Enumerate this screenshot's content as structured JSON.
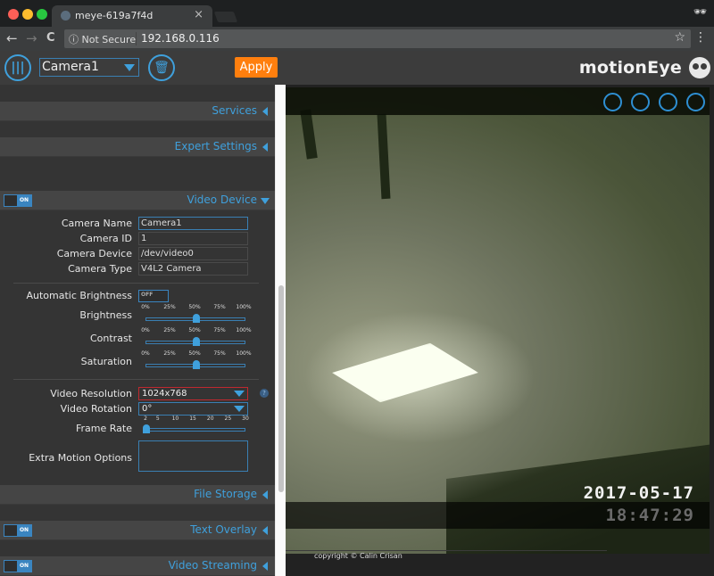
{
  "browser": {
    "tab_title": "meye-619a7f4d",
    "tab_close": "×",
    "security_label": "ⓘ Not Secure",
    "url": "192.168.0.116",
    "back": "←",
    "forward": "→",
    "reload": "C",
    "star": "☆",
    "menu": "⋮",
    "incognito": "🕶",
    "traffic_colors": [
      "#fc5f57",
      "#fdbc2e",
      "#28c840"
    ]
  },
  "header": {
    "menu_icon": "|||",
    "camera_select": "Camera1",
    "delete_icon": "🗑",
    "apply_label": "Apply",
    "brand": "motionEye"
  },
  "sections": {
    "services": "Services",
    "expert_settings": "Expert Settings",
    "video_device": "Video Device",
    "file_storage": "File Storage",
    "text_overlay": "Text Overlay",
    "video_streaming": "Video Streaming",
    "toggle_on": "ON"
  },
  "video_device": {
    "camera_name_label": "Camera Name",
    "camera_name": "Camera1",
    "camera_id_label": "Camera ID",
    "camera_id": "1",
    "camera_device_label": "Camera Device",
    "camera_device": "/dev/video0",
    "camera_type_label": "Camera Type",
    "camera_type": "V4L2 Camera",
    "auto_brightness_label": "Automatic Brightness",
    "auto_brightness_value": "OFF",
    "brightness_label": "Brightness",
    "brightness_value": 50,
    "contrast_label": "Contrast",
    "contrast_value": 50,
    "saturation_label": "Saturation",
    "saturation_value": 50,
    "percent_ticks": [
      "0%",
      "25%",
      "50%",
      "75%",
      "100%"
    ],
    "video_resolution_label": "Video Resolution",
    "video_resolution": "1024x768",
    "help_icon": "?",
    "video_rotation_label": "Video Rotation",
    "video_rotation": "0°",
    "frame_rate_label": "Frame Rate",
    "frame_rate_value": 2,
    "frame_rate_ticks": [
      "2",
      "5",
      "10",
      "15",
      "20",
      "25",
      "30"
    ],
    "extra_motion_label": "Extra Motion Options",
    "extra_motion_value": ""
  },
  "camera_view": {
    "osd_date": "2017-05-17",
    "osd_time": "18:47:29",
    "buttons": [
      "fullscreen",
      "pictures",
      "play",
      "configure"
    ]
  },
  "footer": {
    "copyright": "copyright © Calin Crisan"
  },
  "colors": {
    "accent": "#3fa0dc",
    "apply": "#ff7f0e",
    "error_border": "#c0292f"
  }
}
